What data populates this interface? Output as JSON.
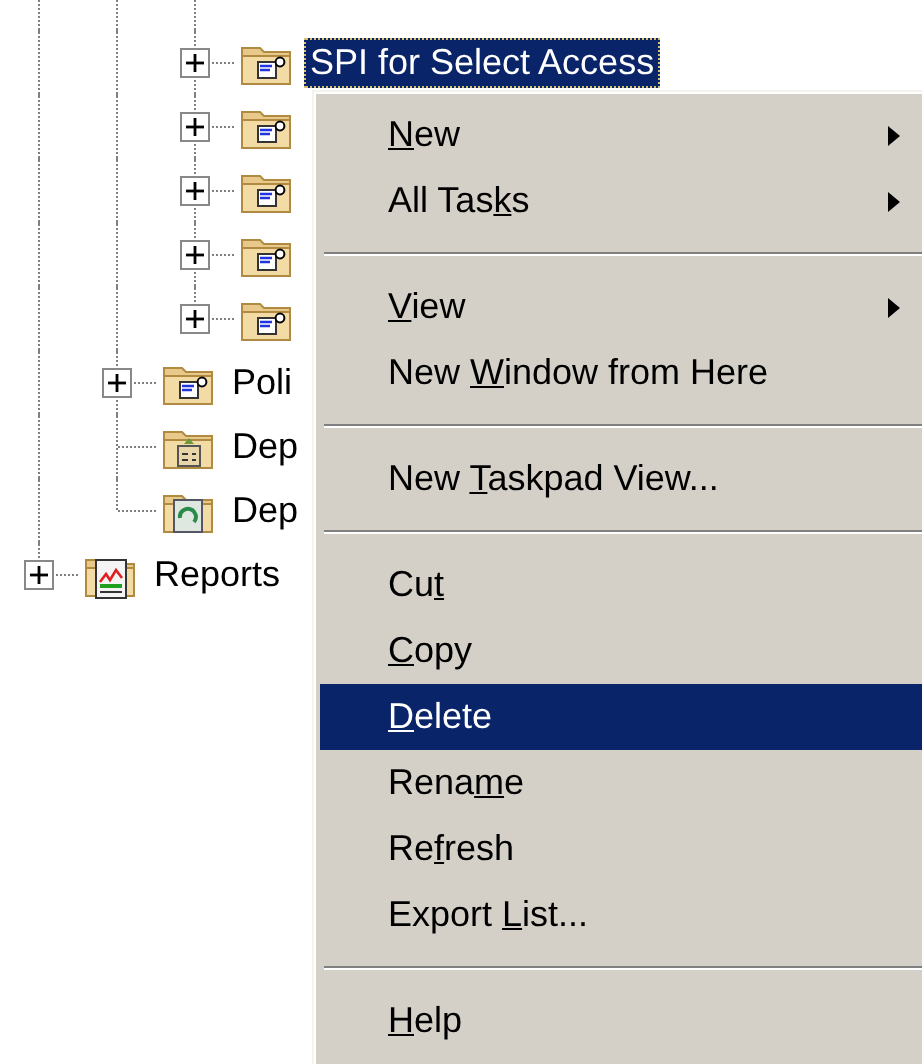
{
  "tree": {
    "items": [
      {
        "children": [
          {
            "children": [
              {
                "label": "SPI for Select Access",
                "kind": "service",
                "expanded": false,
                "selected": true
              },
              {
                "kind": "service",
                "expanded": false
              },
              {
                "kind": "service",
                "expanded": false
              },
              {
                "kind": "service",
                "expanded": false
              },
              {
                "kind": "service",
                "expanded": false
              }
            ]
          },
          {
            "label": "Poli",
            "kind": "service",
            "expanded": false,
            "selected": false
          },
          {
            "label": "Dep",
            "kind": "package",
            "selected": false
          },
          {
            "label": "Dep",
            "kind": "recycle",
            "selected": false
          }
        ]
      },
      {
        "label": "Reports",
        "kind": "report",
        "expanded": false,
        "selected": false
      }
    ]
  },
  "context_menu": {
    "items": [
      {
        "kind": "item",
        "key": "N",
        "after": "ew",
        "submenu": true,
        "selected": false
      },
      {
        "kind": "item",
        "before": "All Tas",
        "key": "k",
        "after": "s",
        "submenu": true,
        "selected": false
      },
      {
        "kind": "separator"
      },
      {
        "kind": "item",
        "key": "V",
        "after": "iew",
        "submenu": true,
        "selected": false
      },
      {
        "kind": "item",
        "before": "New ",
        "key": "W",
        "after": "indow from Here",
        "submenu": false,
        "selected": false
      },
      {
        "kind": "separator"
      },
      {
        "kind": "item",
        "before": "New ",
        "key": "T",
        "after": "askpad View...",
        "submenu": false,
        "selected": false
      },
      {
        "kind": "separator"
      },
      {
        "kind": "item",
        "before": "Cu",
        "key": "t",
        "submenu": false,
        "selected": false
      },
      {
        "kind": "item",
        "key": "C",
        "after": "opy",
        "submenu": false,
        "selected": false
      },
      {
        "kind": "item",
        "key": "D",
        "after": "elete",
        "submenu": false,
        "selected": true
      },
      {
        "kind": "item",
        "before": "Rena",
        "key": "m",
        "after": "e",
        "submenu": false,
        "selected": false
      },
      {
        "kind": "item",
        "before": "Re",
        "key": "f",
        "after": "resh",
        "submenu": false,
        "selected": false
      },
      {
        "kind": "item",
        "before": "Export ",
        "key": "L",
        "after": "ist...",
        "submenu": false,
        "selected": false
      },
      {
        "kind": "separator"
      },
      {
        "kind": "item",
        "key": "H",
        "after": "elp",
        "submenu": false,
        "selected": false
      }
    ]
  }
}
